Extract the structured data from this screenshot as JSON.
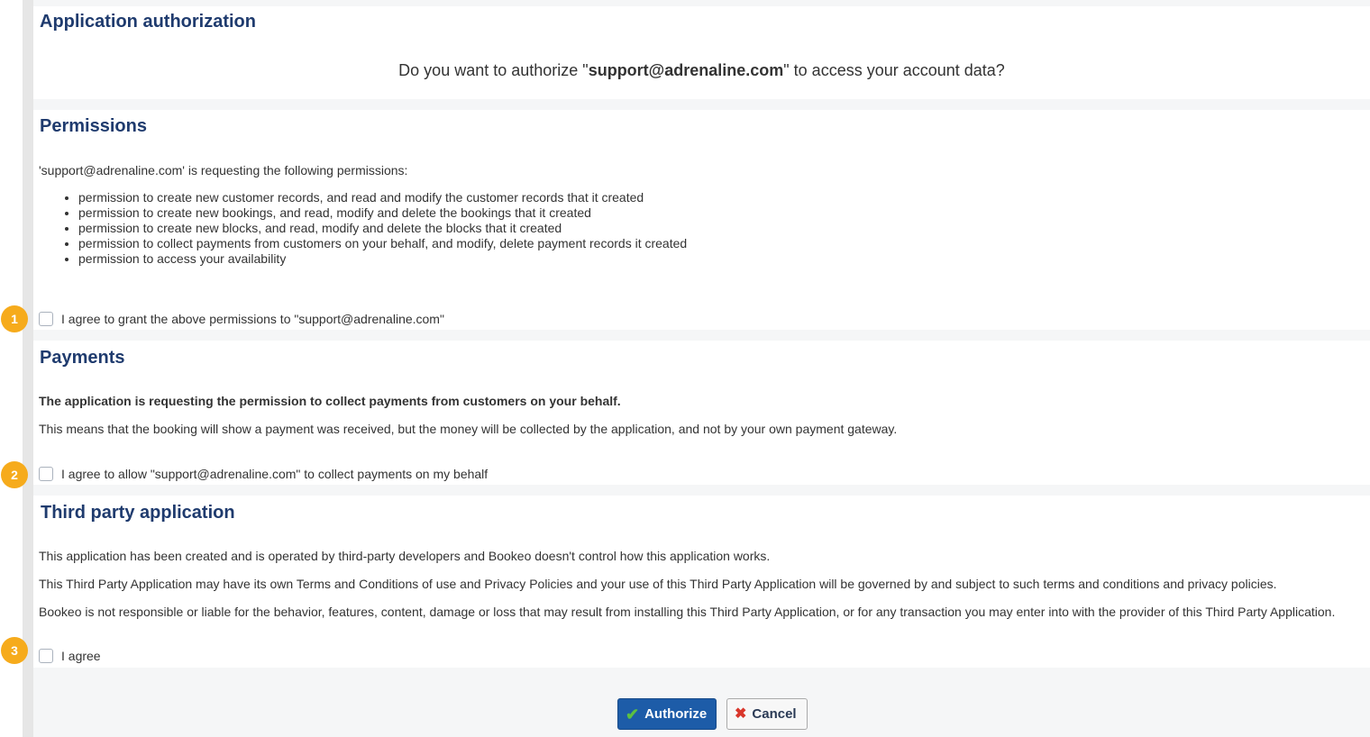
{
  "auth": {
    "title": "Application authorization",
    "question_prefix": "Do you want to authorize \"",
    "question_app": "support@adrenaline.com",
    "question_suffix": "\" to access your account data?"
  },
  "permissions": {
    "title": "Permissions",
    "intro": "'support@adrenaline.com' is requesting the following permissions:",
    "items": [
      "permission to create new customer records, and read and modify the customer records that it created",
      "permission to create new bookings, and read, modify and delete the bookings that it created",
      "permission to create new blocks, and read, modify and delete the blocks that it created",
      "permission to collect payments from customers on your behalf, and modify, delete payment records it created",
      "permission to access your availability"
    ],
    "agree_label": "I agree to grant the above permissions to \"support@adrenaline.com\"",
    "step": "1"
  },
  "payments": {
    "title": "Payments",
    "request": "The application is requesting the permission to collect payments from customers on your behalf.",
    "explain": "This means that the booking will show a payment was received, but the money will be collected by the application, and not by your own payment gateway.",
    "agree_label": "I agree to allow \"support@adrenaline.com\" to collect payments on my behalf",
    "step": "2"
  },
  "third_party": {
    "title": "Third party application",
    "p1": "This application has been created and is operated by third-party developers and Bookeo doesn't control how this application works.",
    "p2": "This Third Party Application may have its own Terms and Conditions of use and Privacy Policies and your use of this Third Party Application will be governed by and subject to such terms and conditions and privacy policies.",
    "p3": "Bookeo is not responsible or liable for the behavior, features, content, damage or loss that may result from installing this Third Party Application, or for any transaction you may enter into with the provider of this Third Party Application.",
    "agree_label": "I agree",
    "step": "3"
  },
  "actions": {
    "authorize_label": "Authorize",
    "cancel_label": "Cancel"
  },
  "colors": {
    "heading": "#1f3b6e",
    "primary": "#1d5ca8",
    "step_badge": "#f6ab1c"
  }
}
